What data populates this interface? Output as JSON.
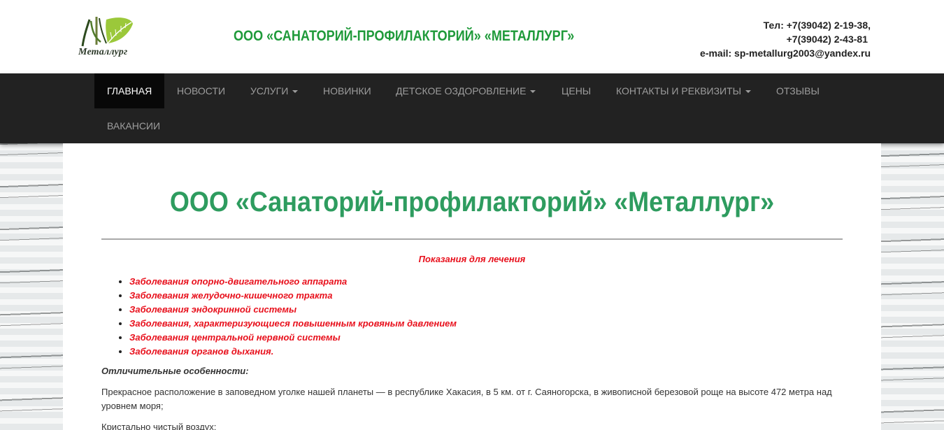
{
  "header": {
    "logo_text": "Металлург",
    "site_title": "ООО «САНАТОРИЙ-ПРОФИЛАКТОРИЙ» «МЕТАЛЛУРГ»",
    "phone_line1": "Тел: +7(39042) 2-19-38,",
    "phone_line2": "+7(39042) 2-43-81",
    "email_line": "e-mail: sp-metallurg2003@yandex.ru"
  },
  "nav": {
    "items": [
      {
        "label": "ГЛАВНАЯ"
      },
      {
        "label": "НОВОСТИ"
      },
      {
        "label": "УСЛУГИ"
      },
      {
        "label": "НОВИНКИ"
      },
      {
        "label": "ДЕТСКОЕ ОЗДОРОВЛЕНИЕ"
      },
      {
        "label": "ЦЕНЫ"
      },
      {
        "label": "КОНТАКТЫ И РЕКВИЗИТЫ"
      },
      {
        "label": "ОТЗЫВЫ"
      },
      {
        "label": "ВАКАНСИИ"
      }
    ]
  },
  "main": {
    "title": "ООО «Санаторий-профилакторий» «Металлург»",
    "indications_heading": "Показания для лечения",
    "indications": [
      "Заболевания опорно-двигательного аппарата",
      "Заболевания желудочно-кишечного тракта",
      "Заболевания эндокринной системы",
      "Заболевания, характеризующиеся повышенным кровяным давлением",
      "Заболевания центральной нервной системы",
      "Заболевания органов дыхания."
    ],
    "features_heading": "Отличительные особенности:",
    "paragraph1": "Прекрасное расположение в заповедном уголке нашей планеты — в республике Хакасия, в 5 км. от г. Саяногорска, в живописной березовой роще на высоте 472 метра над уровнем моря;",
    "paragraph2": "Кристально чистый воздух;"
  },
  "colors": {
    "title_green": "#2e9c5f",
    "header_green": "#1f9a3a",
    "indication_red": "#e8101c",
    "navbar_bg": "#222222"
  }
}
